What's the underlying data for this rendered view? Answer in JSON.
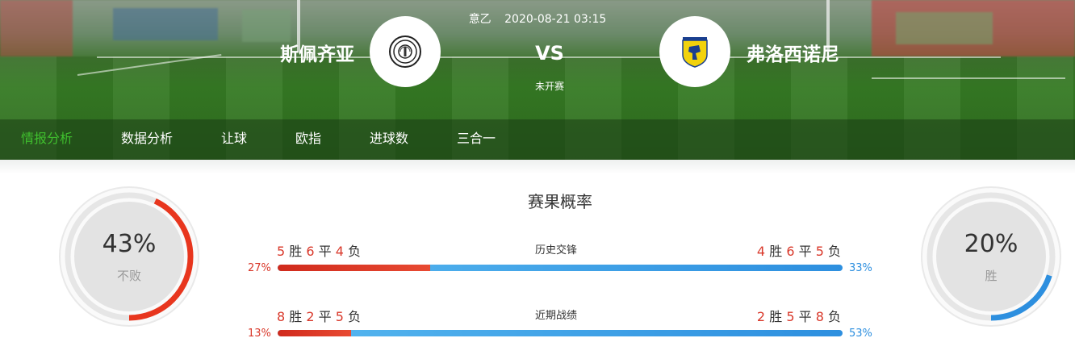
{
  "match": {
    "league": "意乙",
    "datetime": "2020-08-21 03:15",
    "vs": "VS",
    "status": "未开赛",
    "home_team": "斯佩齐亚",
    "away_team": "弗洛西诺尼",
    "home_logo_icon": "spezia-crest-icon",
    "away_logo_icon": "frosinone-crest-icon"
  },
  "tabs": [
    {
      "label": "情报分析",
      "active": true
    },
    {
      "label": "数据分析",
      "active": false
    },
    {
      "label": "让球",
      "active": false
    },
    {
      "label": "欧指",
      "active": false
    },
    {
      "label": "进球数",
      "active": false
    },
    {
      "label": "三合一",
      "active": false
    }
  ],
  "probability": {
    "title": "赛果概率",
    "home": {
      "value": "43%",
      "label": "不败",
      "fraction": 0.43,
      "color": "#e8361e"
    },
    "away": {
      "value": "20%",
      "label": "胜",
      "fraction": 0.2,
      "color": "#2d8fdf"
    }
  },
  "rows": [
    {
      "title": "历史交锋",
      "home_record": {
        "w": "5",
        "d": "6",
        "l": "4"
      },
      "away_record": {
        "w": "4",
        "d": "6",
        "l": "5"
      },
      "home_pct": "27%",
      "away_pct": "33%",
      "home_fraction": 0.27
    },
    {
      "title": "近期战绩",
      "home_record": {
        "w": "8",
        "d": "2",
        "l": "5"
      },
      "away_record": {
        "w": "2",
        "d": "5",
        "l": "8"
      },
      "home_pct": "13%",
      "away_pct": "53%",
      "home_fraction": 0.13
    }
  ],
  "record_words": {
    "w": "胜",
    "d": "平",
    "l": "负"
  },
  "colors": {
    "win": "#d9382a",
    "active_tab": "#3fbf2e",
    "home_bar": "#d02a1c",
    "away_bar": "#2d8fdf"
  }
}
